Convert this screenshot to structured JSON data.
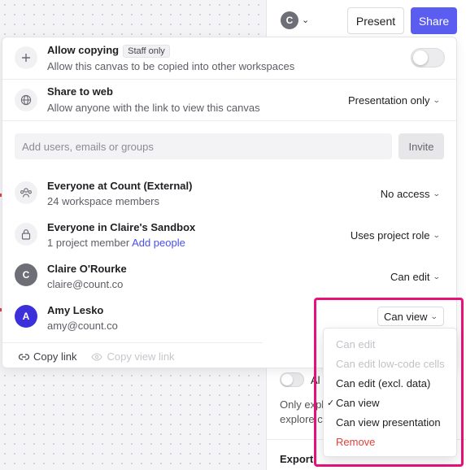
{
  "topbar": {
    "avatar_initial": "C",
    "present_label": "Present",
    "share_label": "Share"
  },
  "background_panel": {
    "toggle_label_partial": "Al",
    "description_line1": "Only expl",
    "description_line2": "explore c",
    "export_label": "Export"
  },
  "modal": {
    "allow_copying": {
      "title": "Allow copying",
      "badge": "Staff only",
      "subtitle": "Allow this canvas to be copied into other workspaces",
      "enabled": false
    },
    "share_to_web": {
      "title": "Share to web",
      "subtitle": "Allow anyone with the link to view this canvas",
      "value": "Presentation only"
    },
    "invite": {
      "placeholder": "Add users, emails or groups",
      "button_label": "Invite"
    },
    "members": [
      {
        "name": "Everyone at Count (External)",
        "detail": "24 workspace members",
        "role": "No access",
        "icon": "group-icon"
      },
      {
        "name": "Everyone in Claire's Sandbox",
        "detail": "1 project member",
        "detail_link": "Add people",
        "role": "Uses project role",
        "icon": "lock-icon"
      },
      {
        "name": "Claire O'Rourke",
        "detail": "claire@count.co",
        "role": "Can edit",
        "initial": "C",
        "avatar_color": "#6e6e76"
      },
      {
        "name": "Amy Lesko",
        "detail": "amy@count.co",
        "role": "Can view",
        "initial": "A",
        "avatar_color": "#3b30d9"
      }
    ],
    "footer": {
      "copy_link": "Copy link",
      "copy_view_link": "Copy view link"
    }
  },
  "role_menu": {
    "options": [
      {
        "label": "Can edit",
        "state": "disabled"
      },
      {
        "label": "Can edit low-code cells",
        "state": "disabled"
      },
      {
        "label": "Can edit (excl. data)",
        "state": "normal"
      },
      {
        "label": "Can view",
        "state": "selected"
      },
      {
        "label": "Can view presentation",
        "state": "normal"
      },
      {
        "label": "Remove",
        "state": "danger"
      }
    ]
  },
  "colors": {
    "accent": "#5b5cf0",
    "highlight": "#e8117a",
    "danger": "#e0413a",
    "link": "#4a4ff0"
  }
}
